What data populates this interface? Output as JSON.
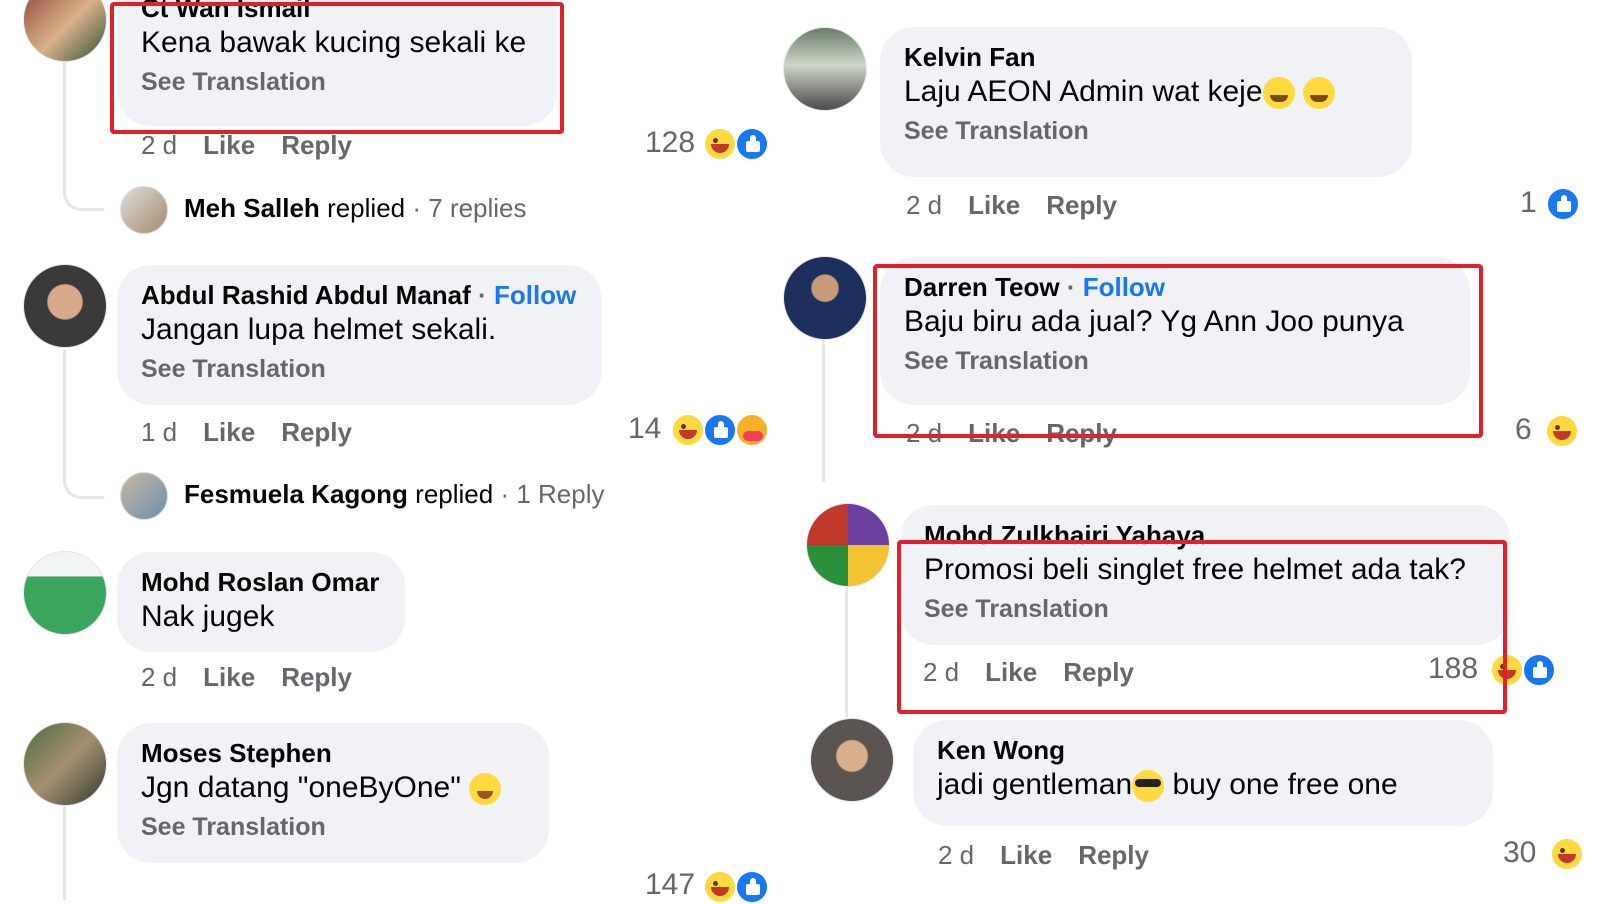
{
  "colors": {
    "accent": "#1877f2",
    "bubble": "#f0f2f5",
    "muted": "#65676b",
    "highlight": "#e0202a"
  },
  "left": {
    "c1": {
      "name": "Ct Wan Ismail",
      "text": "Kena bawak kucing sekali ke",
      "translate": "See Translation",
      "time": "2 d",
      "like": "Like",
      "reply": "Reply",
      "count": "128"
    },
    "r1": {
      "name": "Meh Salleh",
      "verb": "replied",
      "info": "· 7 replies"
    },
    "c2": {
      "name": "Abdul Rashid Abdul Manaf",
      "sep": "·",
      "follow": "Follow",
      "text": "Jangan lupa helmet sekali.",
      "translate": "See Translation",
      "time": "1 d",
      "like": "Like",
      "reply": "Reply",
      "count": "14"
    },
    "r2": {
      "name": "Fesmuela Kagong",
      "verb": "replied",
      "info": "· 1 Reply"
    },
    "c3": {
      "name": "Mohd Roslan Omar",
      "text": "Nak jugek",
      "time": "2 d",
      "like": "Like",
      "reply": "Reply"
    },
    "c4": {
      "name": "Moses Stephen",
      "text": "Jgn datang \"oneByOne\"",
      "translate": "See Translation",
      "count": "147"
    }
  },
  "right": {
    "c1": {
      "name": "Kelvin Fan",
      "text": "Laju AEON Admin wat keje",
      "translate": "See Translation",
      "time": "2 d",
      "like": "Like",
      "reply": "Reply",
      "count": "1"
    },
    "c2": {
      "name": "Darren Teow",
      "sep": "·",
      "follow": "Follow",
      "text": "Baju biru ada jual? Yg Ann Joo punya",
      "translate": "See Translation",
      "time": "2 d",
      "like": "Like",
      "reply": "Reply",
      "count": "6"
    },
    "c3": {
      "name": "Mohd Zulkhairi Yahaya",
      "text": "Promosi beli singlet free helmet ada tak?",
      "translate": "See Translation",
      "time": "2 d",
      "like": "Like",
      "reply": "Reply",
      "count": "188"
    },
    "c4": {
      "name": "Ken Wong",
      "text_a": "jadi gentleman",
      "text_b": "buy one free one",
      "time": "2 d",
      "like": "Like",
      "reply": "Reply",
      "count": "30"
    }
  }
}
